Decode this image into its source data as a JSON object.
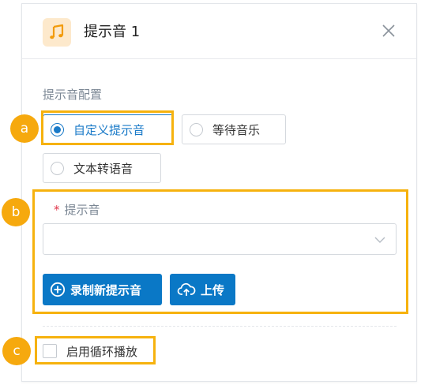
{
  "dialog": {
    "title": "提示音 1",
    "section_label": "提示音配置",
    "options": [
      {
        "label": "自定义提示音",
        "selected": true
      },
      {
        "label": "等待音乐",
        "selected": false
      },
      {
        "label": "文本转语音",
        "selected": false
      }
    ],
    "field": {
      "required_mark": "*",
      "label": "提示音",
      "select_value": ""
    },
    "buttons": {
      "record": "录制新提示音",
      "upload": "上传"
    },
    "loop": {
      "label": "启用循环播放",
      "checked": false
    }
  },
  "annotations": {
    "markers": [
      "a",
      "b",
      "c"
    ],
    "highlight_color": "#f6b20e",
    "marker_color": "#f6a90e"
  },
  "colors": {
    "accent": "#0a78c6",
    "icon_bg": "#fde9cc",
    "icon_fg": "#f29b0b",
    "required": "#e0364a"
  }
}
